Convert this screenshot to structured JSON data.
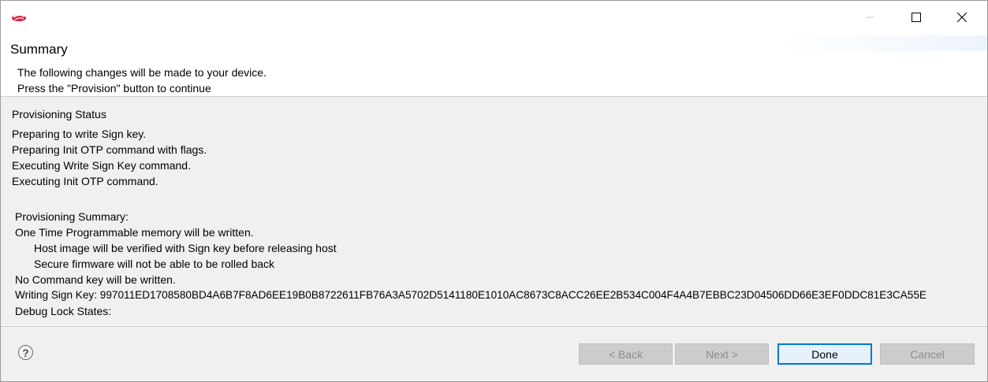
{
  "window": {
    "buttons": {
      "minimize_icon": "minimize-icon",
      "maximize_icon": "maximize-icon",
      "close_icon": "close-icon"
    },
    "app_icon": "silicon-labs-logo-icon"
  },
  "header": {
    "title": "Summary",
    "lines": [
      "The following changes will be made to your device.",
      "Press the \"Provision\" button to continue"
    ]
  },
  "status": {
    "heading": "Provisioning Status",
    "lines": [
      "Preparing to write Sign key.",
      "Preparing Init OTP command with flags.",
      "Executing Write Sign Key command.",
      "Executing Init OTP command."
    ]
  },
  "summary": {
    "heading": "Provisioning Summary:",
    "otp": "One Time Programmable memory will be written.",
    "otp_details": [
      "Host image will be verified with Sign key before releasing host",
      "Secure firmware will not be able to be rolled back"
    ],
    "command_key": "No Command key will be written.",
    "sign_key": "Writing Sign Key: 997011ED1708580BD4A6B7F8AD6EE19B0B8722611FB76A3A5702D5141180E1010AC8673C8ACC26EE2B534C004F4A4B7EBBC23D04506DD66E3EF0DDC81E3CA55E",
    "debug_lock": "Debug Lock States:"
  },
  "footer": {
    "help_glyph": "?",
    "back_label": "< Back",
    "next_label": "Next >",
    "done_label": "Done",
    "cancel_label": "Cancel"
  },
  "colors": {
    "content_bg": "#f0f0f0",
    "accent": "#0078d7",
    "disabled_text": "#8c8c8c",
    "logo_red": "#d91e3c"
  }
}
